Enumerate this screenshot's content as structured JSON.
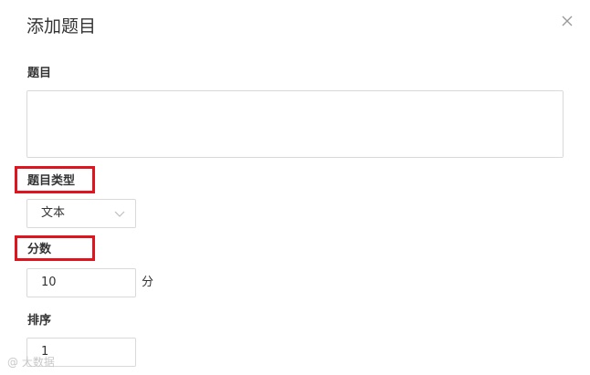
{
  "dialog": {
    "title": "添加题目",
    "close_icon": "close-icon"
  },
  "fields": {
    "question": {
      "label": "题目",
      "value": ""
    },
    "question_type": {
      "label": "题目类型",
      "selected": "文本",
      "arrow_icon": "chevron-down-icon"
    },
    "score": {
      "label": "分数",
      "value": "10",
      "unit": "分"
    },
    "order": {
      "label": "排序",
      "value": "1"
    }
  },
  "watermark": {
    "text": "@ 大数据"
  },
  "colors": {
    "highlight": "#e0141e",
    "border": "#d9d9d9",
    "text": "#333333"
  }
}
